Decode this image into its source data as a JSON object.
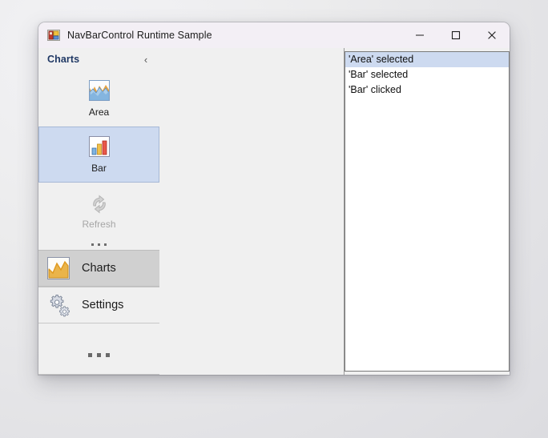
{
  "window": {
    "title": "NavBarControl Runtime Sample",
    "app_icon": "navbar-app-icon",
    "controls": {
      "minimize": "—",
      "maximize": "☐",
      "close": "✕",
      "minimize_name": "minimize",
      "maximize_name": "maximize",
      "close_name": "close"
    }
  },
  "navbar": {
    "group_caption": {
      "label": "Charts",
      "collapse_glyph": "‹"
    },
    "items": [
      {
        "label": "Area",
        "icon": "area-chart-icon",
        "state": "normal",
        "selected": false
      },
      {
        "label": "Bar",
        "icon": "bar-chart-icon",
        "state": "normal",
        "selected": true
      },
      {
        "label": "Refresh",
        "icon": "refresh-icon",
        "state": "disabled",
        "selected": false
      }
    ],
    "overflow_glyph": "...",
    "groups": [
      {
        "label": "Charts",
        "icon": "line-chart-icon",
        "active": true
      },
      {
        "label": "Settings",
        "icon": "gears-icon",
        "active": false
      }
    ],
    "bottom_overflow": "..."
  },
  "log": {
    "entries": [
      {
        "text": "'Area' selected",
        "selected": true
      },
      {
        "text": "'Bar' selected",
        "selected": false
      },
      {
        "text": "'Bar' clicked",
        "selected": false
      }
    ]
  },
  "colors": {
    "accent_selection": "#cddaf0",
    "group_caption_text": "#1f3864",
    "active_group_band": "#d0d0d0",
    "titlebar": "#f3eff5",
    "panel": "#f0f0f0"
  }
}
